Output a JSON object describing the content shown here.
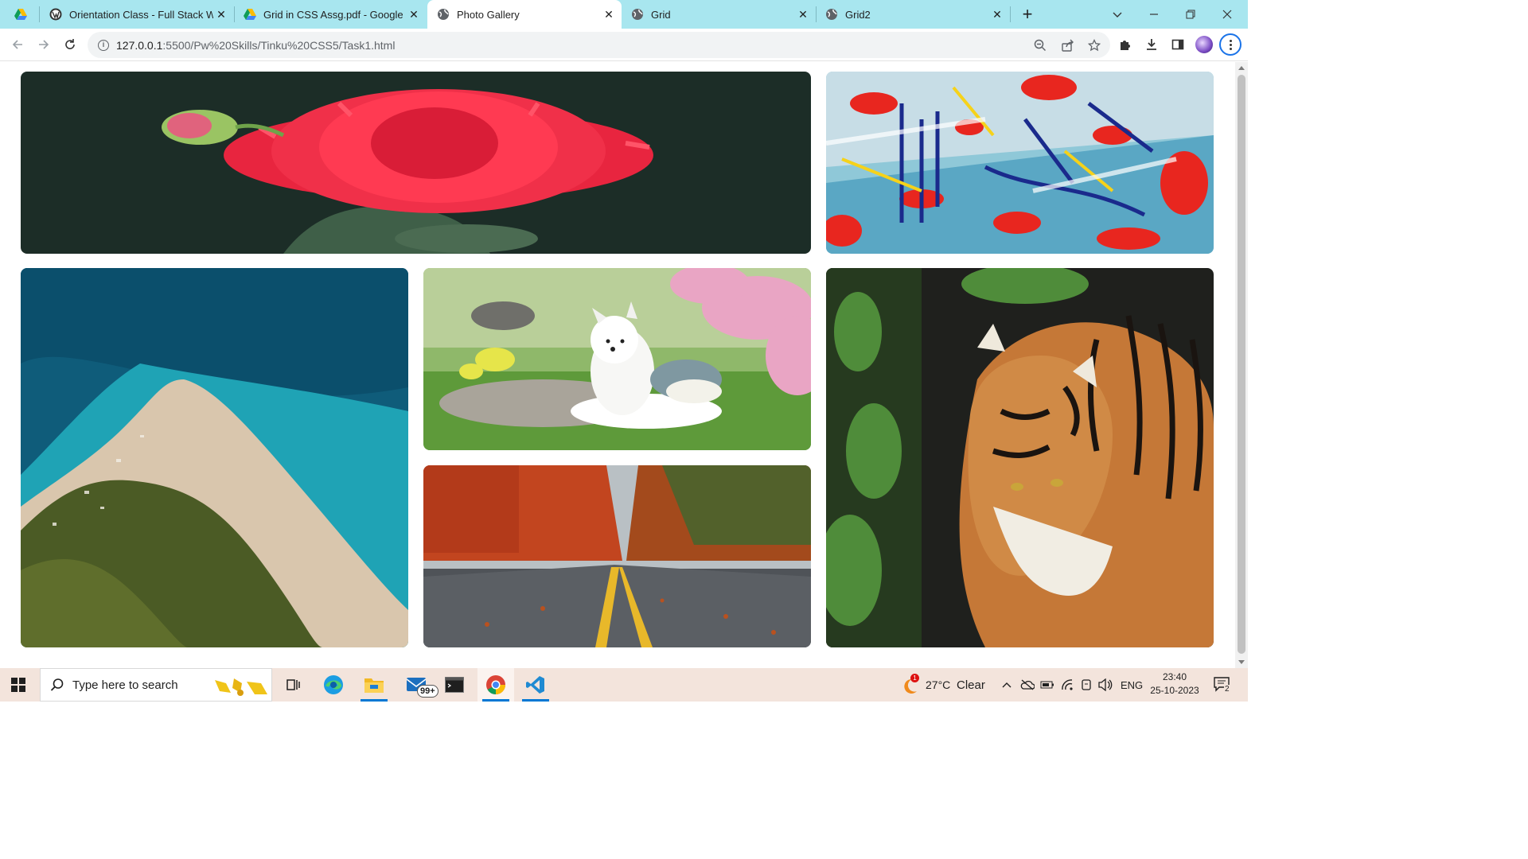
{
  "browser": {
    "tabs": [
      {
        "title": "",
        "favicon": "google-drive-icon"
      },
      {
        "title": "Orientation Class - Full Stack We",
        "favicon": "wordpress-icon"
      },
      {
        "title": "Grid in CSS Assg.pdf - Google D",
        "favicon": "google-drive-icon"
      },
      {
        "title": "Photo Gallery",
        "favicon": "globe-icon",
        "active": true
      },
      {
        "title": "Grid",
        "favicon": "globe-icon"
      },
      {
        "title": "Grid2",
        "favicon": "globe-icon"
      }
    ],
    "new_tab_label": "+",
    "close_glyph": "✕",
    "address": {
      "host": "127.0.0.1",
      "path": ":5500/Pw%20Skills/Tinku%20CSS5/Task1.html"
    }
  },
  "gallery": {
    "photos": [
      {
        "name": "red-dahlia-flower"
      },
      {
        "name": "abstract-paint-art"
      },
      {
        "name": "aerial-beach"
      },
      {
        "name": "white-spitz-dog"
      },
      {
        "name": "autumn-road"
      },
      {
        "name": "tiger-in-forest"
      }
    ]
  },
  "taskbar": {
    "search_placeholder": "Type here to search",
    "mail_badge": "99+",
    "weather": {
      "temp": "27°C",
      "condition": "Clear",
      "alert": "1"
    },
    "language": "ENG",
    "time": "23:40",
    "date": "25-10-2023",
    "notification_count": "2"
  },
  "colors": {
    "tab_strip": "#a8e6ef",
    "accent": "#1a73e8",
    "taskbar": "#f3e4dc"
  }
}
